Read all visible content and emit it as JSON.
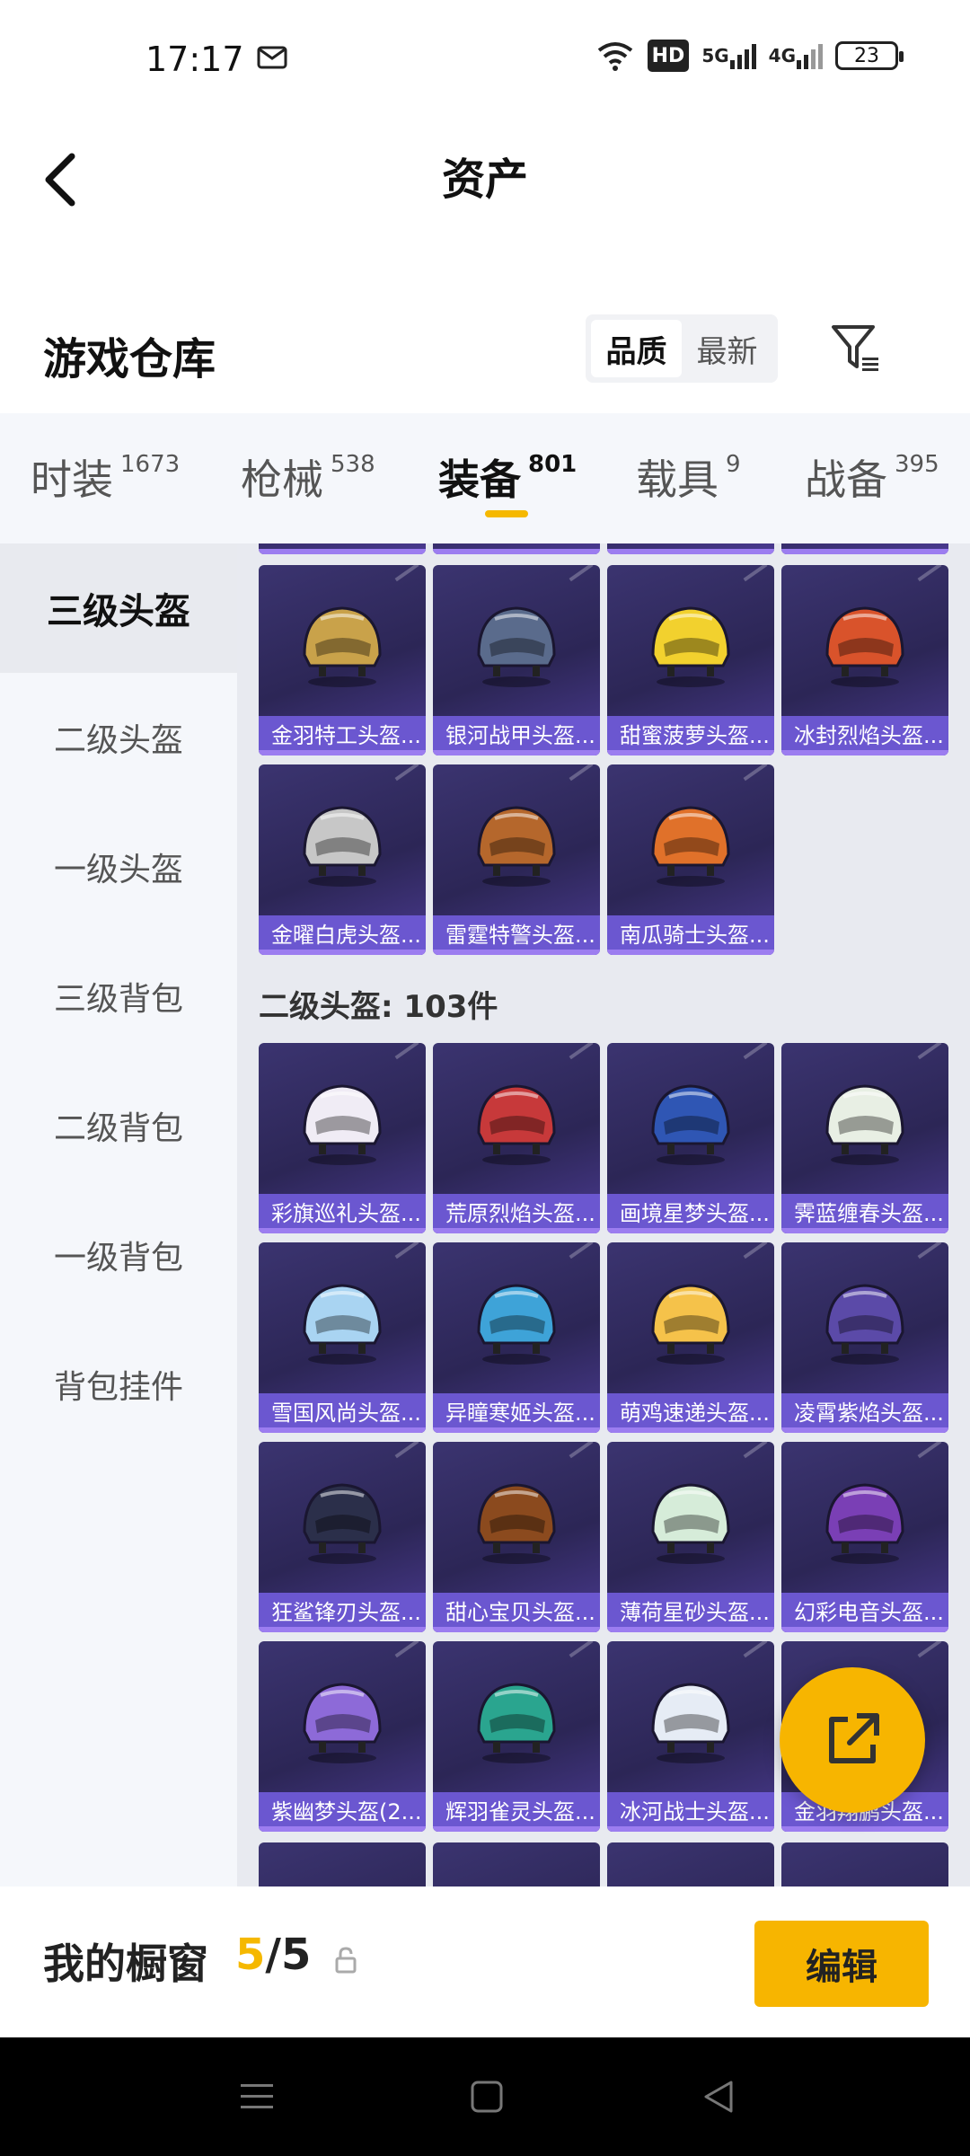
{
  "status": {
    "time": "17:17",
    "network_5g": "5G",
    "network_4g": "4G",
    "hd": "HD",
    "battery": "23"
  },
  "header": {
    "title": "资产"
  },
  "warehouse": {
    "title": "游戏仓库",
    "sort_options": [
      "品质",
      "最新"
    ],
    "sort_active": "品质"
  },
  "category_tabs": [
    {
      "label": "时装",
      "count": "1673"
    },
    {
      "label": "枪械",
      "count": "538"
    },
    {
      "label": "装备",
      "count": "801",
      "active": true
    },
    {
      "label": "载具",
      "count": "9"
    },
    {
      "label": "战备",
      "count": "395"
    }
  ],
  "sidebar": [
    {
      "label": "三级头盔",
      "active": true
    },
    {
      "label": "二级头盔"
    },
    {
      "label": "一级头盔"
    },
    {
      "label": "三级背包"
    },
    {
      "label": "二级背包"
    },
    {
      "label": "一级背包"
    },
    {
      "label": "背包挂件"
    }
  ],
  "level3_items": [
    {
      "name": "金羽特工头盔...",
      "color": "#c9a24a"
    },
    {
      "name": "银河战甲头盔...",
      "color": "#5a6b8c"
    },
    {
      "name": "甜蜜菠萝头盔...",
      "color": "#f2d12e"
    },
    {
      "name": "冰封烈焰头盔...",
      "color": "#d9532b"
    },
    {
      "name": "金曜白虎头盔...",
      "color": "#c7c7c7"
    },
    {
      "name": "雷霆特警头盔...",
      "color": "#b5672c"
    },
    {
      "name": "南瓜骑士头盔...",
      "color": "#e0712a"
    }
  ],
  "level2_section": {
    "title": "二级头盔: 103件"
  },
  "level2_items": [
    {
      "name": "彩旗巡礼头盔...",
      "color": "#f0ecf5"
    },
    {
      "name": "荒原烈焰头盔...",
      "color": "#c7393a"
    },
    {
      "name": "画境星梦头盔...",
      "color": "#2f56b4"
    },
    {
      "name": "霁蓝缠春头盔...",
      "color": "#e8efe4"
    },
    {
      "name": "雪国风尚头盔...",
      "color": "#a9d4f2"
    },
    {
      "name": "异瞳寒姬头盔...",
      "color": "#3ea3d8"
    },
    {
      "name": "萌鸡速递头盔...",
      "color": "#f5c24a"
    },
    {
      "name": "凌霄紫焰头盔...",
      "color": "#5b4aa8"
    },
    {
      "name": "狂鲨锋刃头盔...",
      "color": "#2b2f4a"
    },
    {
      "name": "甜心宝贝头盔...",
      "color": "#8b4a1e"
    },
    {
      "name": "薄荷星砂头盔...",
      "color": "#d6ecd9"
    },
    {
      "name": "幻彩电音头盔...",
      "color": "#7a3fb5"
    },
    {
      "name": "紫幽梦头盔(2...",
      "color": "#8d6ad8"
    },
    {
      "name": "辉羽雀灵头盔...",
      "color": "#2aa58f"
    },
    {
      "name": "冰河战士头盔...",
      "color": "#e6ecf5"
    },
    {
      "name": "金羽翔鹏头盔...",
      "color": "#d6a640"
    }
  ],
  "bottom": {
    "showcase_label": "我的橱窗",
    "count_current": "5",
    "count_sep": "/",
    "count_total": "5",
    "edit_label": "编辑"
  },
  "icons": {
    "back": "back-arrow-icon",
    "filter": "filter-icon",
    "share": "share-external-icon",
    "lock": "lock-icon"
  }
}
